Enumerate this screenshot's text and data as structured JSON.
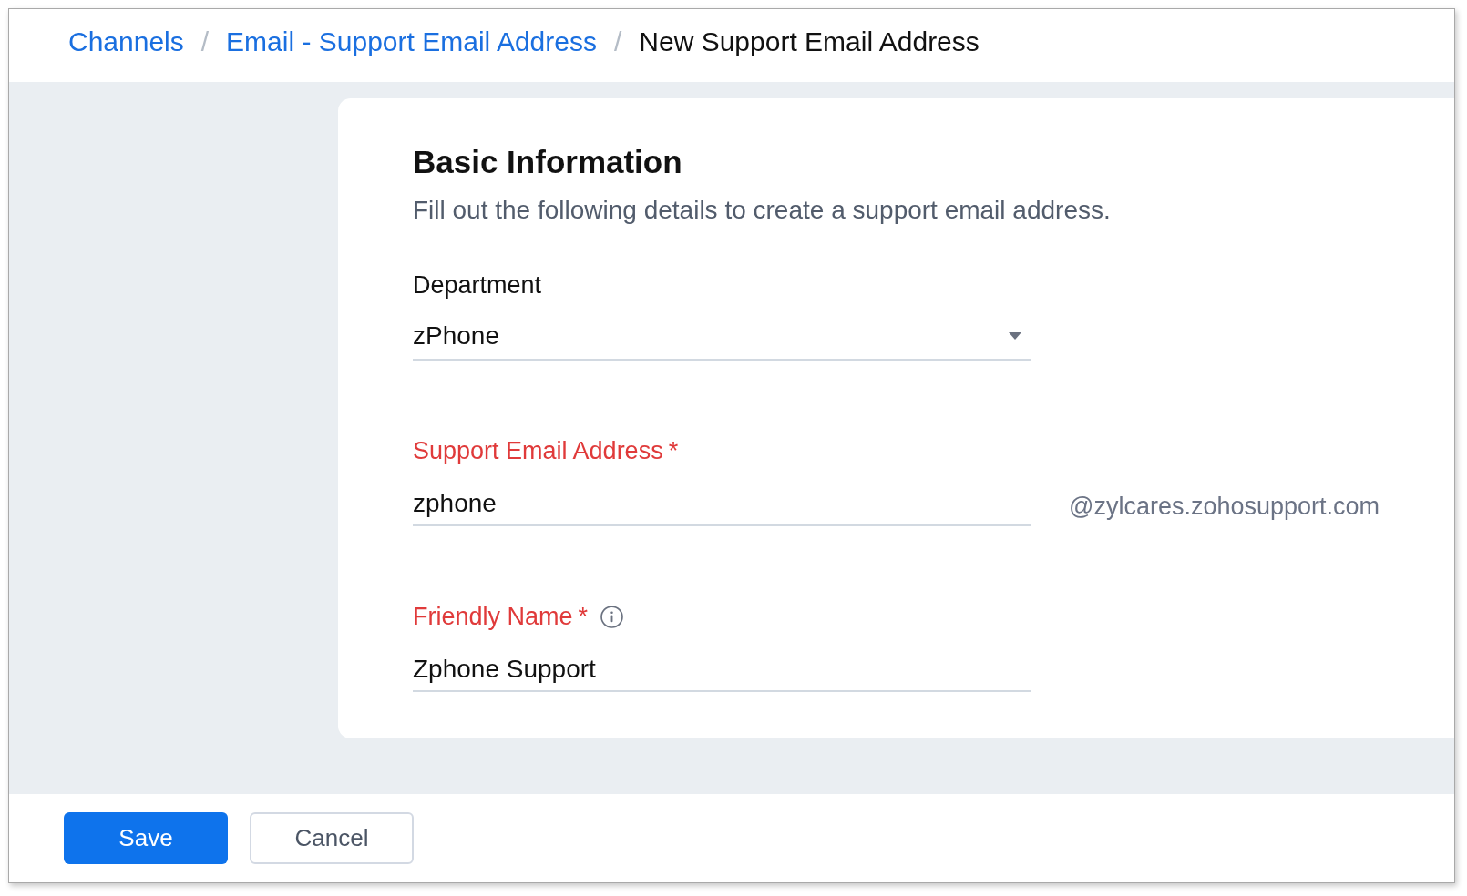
{
  "breadcrumb": [
    {
      "kind": "link",
      "label": "Channels"
    },
    {
      "kind": "separator",
      "label": "/"
    },
    {
      "kind": "link",
      "label": "Email - Support Email Address"
    },
    {
      "kind": "separator",
      "label": "/"
    },
    {
      "kind": "current",
      "label": "New Support Email Address"
    }
  ],
  "form": {
    "title": "Basic Information",
    "description": "Fill out the following details to create a support email address.",
    "fields": [
      {
        "kind": "select",
        "label": "Department",
        "required": false,
        "info": false,
        "value": "zPhone"
      },
      {
        "kind": "text",
        "label": "Support Email Address",
        "required": true,
        "required_mark": "*",
        "info": false,
        "value": "zphone",
        "suffix": "@zylcares.zohosupport.com"
      },
      {
        "kind": "text",
        "label": "Friendly Name",
        "required": true,
        "required_mark": "*",
        "info": true,
        "value": "Zphone Support"
      }
    ]
  },
  "buttons": [
    {
      "kind": "primary",
      "label": "Save"
    },
    {
      "kind": "secondary",
      "label": "Cancel"
    }
  ]
}
